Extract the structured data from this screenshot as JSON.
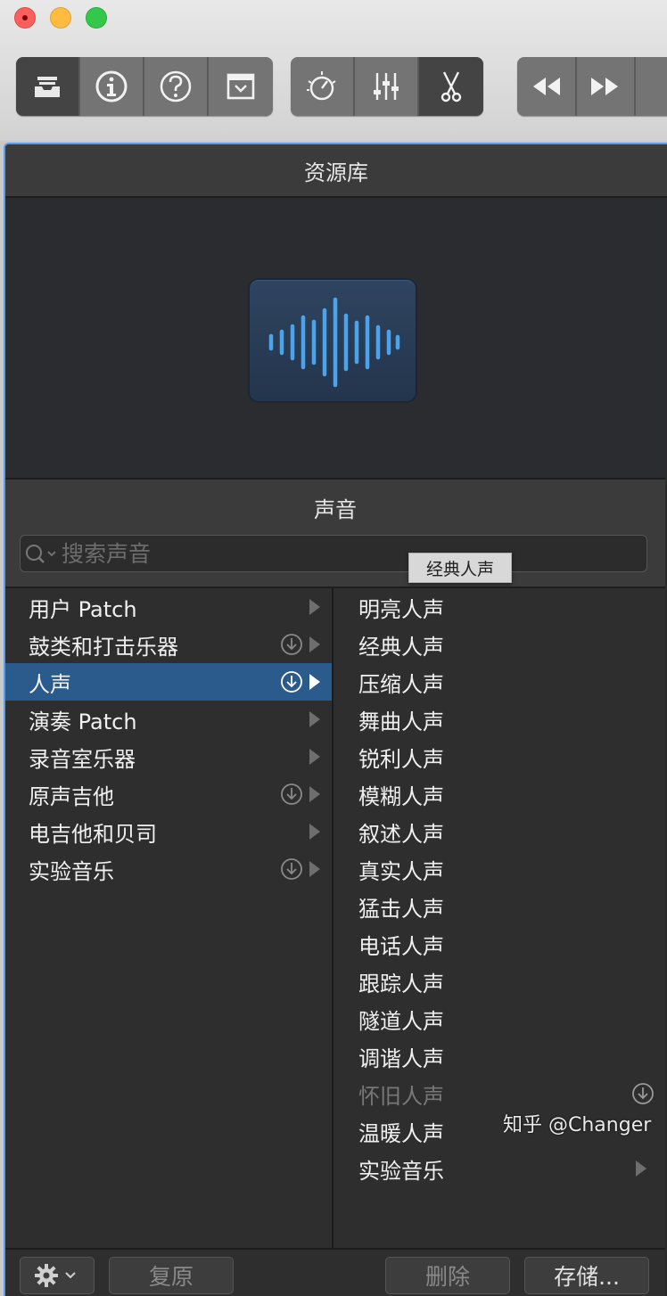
{
  "library": {
    "title": "资源库"
  },
  "sounds": {
    "title": "声音",
    "search_placeholder": "搜索声音"
  },
  "toolbar": {
    "buttons": [
      {
        "icon": "library-icon",
        "selected": true
      },
      {
        "icon": "info-icon"
      },
      {
        "icon": "help-icon"
      },
      {
        "icon": "editors-icon"
      },
      {
        "icon": "smart-controls-icon"
      },
      {
        "icon": "mixer-icon"
      },
      {
        "icon": "scissors-icon",
        "selected": true
      },
      {
        "icon": "rewind-icon"
      },
      {
        "icon": "fast-forward-icon"
      }
    ]
  },
  "categories": [
    {
      "label": "用户 Patch",
      "download": false
    },
    {
      "label": "鼓类和打击乐器",
      "download": true
    },
    {
      "label": "人声",
      "download": true,
      "selected": true
    },
    {
      "label": "演奏 Patch",
      "download": false
    },
    {
      "label": "录音室乐器",
      "download": false
    },
    {
      "label": "原声吉他",
      "download": true
    },
    {
      "label": "电吉他和贝司",
      "download": false
    },
    {
      "label": "实验音乐",
      "download": true
    }
  ],
  "patches": [
    {
      "label": "明亮人声"
    },
    {
      "label": "经典人声"
    },
    {
      "label": "压缩人声"
    },
    {
      "label": "舞曲人声"
    },
    {
      "label": "锐利人声"
    },
    {
      "label": "模糊人声"
    },
    {
      "label": "叙述人声"
    },
    {
      "label": "真实人声"
    },
    {
      "label": "猛击人声"
    },
    {
      "label": "电话人声"
    },
    {
      "label": "跟踪人声"
    },
    {
      "label": "隧道人声"
    },
    {
      "label": "调谐人声"
    },
    {
      "label": "怀旧人声",
      "dim": true,
      "download": true
    },
    {
      "label": "温暖人声"
    },
    {
      "label": "实验音乐",
      "submenu": true
    }
  ],
  "tooltip": {
    "text": "经典人声"
  },
  "footer": {
    "revert_label": "复原",
    "delete_label": "删除",
    "save_label": "存储..."
  },
  "watermark": {
    "text": "知乎 @Changer"
  },
  "colors": {
    "accent": "#2b5b8c",
    "waveform": "#4ba3ea",
    "panel_bg": "#2e2e2e"
  }
}
